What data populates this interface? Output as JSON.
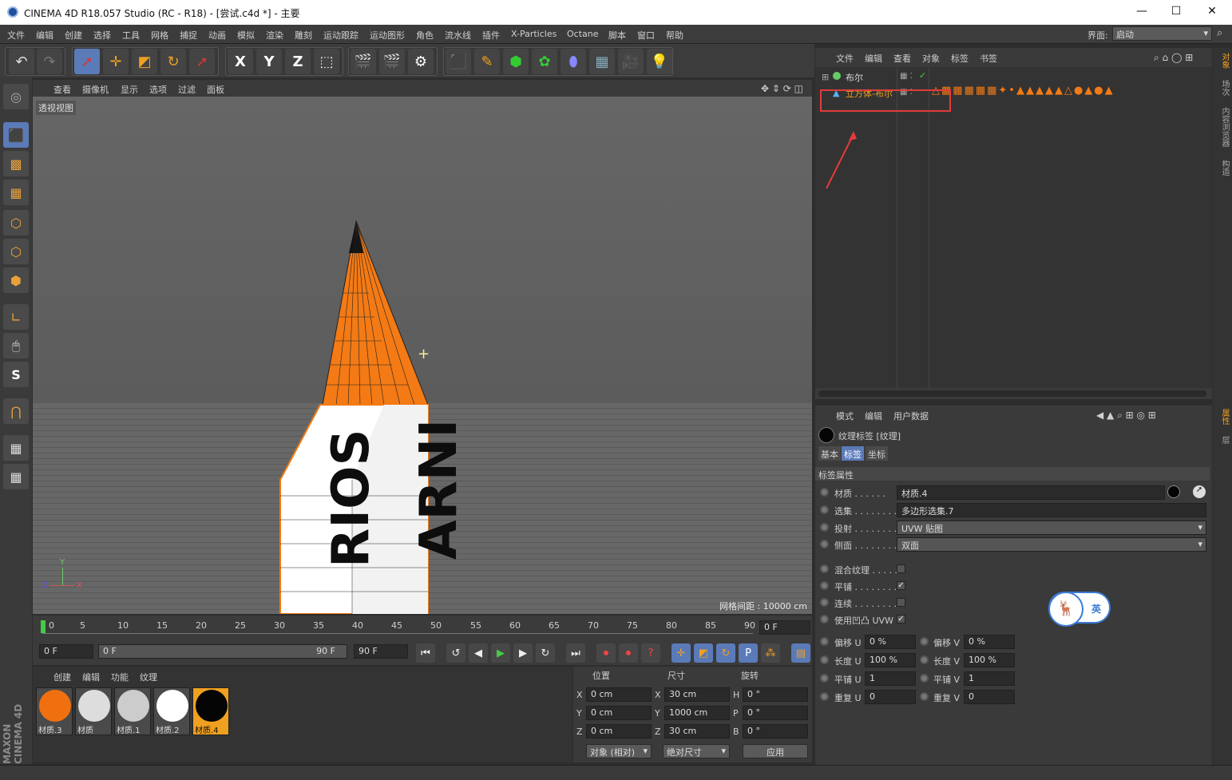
{
  "window": {
    "title": "CINEMA 4D R18.057 Studio (RC - R18) - [尝试.c4d *] - 主要",
    "min": "—",
    "max": "☐",
    "close": "✕"
  },
  "menu": [
    "文件",
    "编辑",
    "创建",
    "选择",
    "工具",
    "网格",
    "捕捉",
    "动画",
    "模拟",
    "渲染",
    "雕刻",
    "运动跟踪",
    "运动图形",
    "角色",
    "流水线",
    "插件",
    "X-Particles",
    "Octane",
    "脚本",
    "窗口",
    "帮助"
  ],
  "layout": {
    "label": "界面:",
    "value": "启动"
  },
  "toolbar": {
    "axis": [
      "X",
      "Y",
      "Z"
    ]
  },
  "viewport": {
    "menu": [
      "查看",
      "摄像机",
      "显示",
      "选项",
      "过滤",
      "面板"
    ],
    "label": "透视视图",
    "grid": "网格间距 : 10000 cm",
    "axis_y": "Y",
    "axis_z": "Z",
    "axis_x": "X",
    "crosshair": "+"
  },
  "timeline": {
    "ticks": [
      "0",
      "5",
      "10",
      "15",
      "20",
      "25",
      "30",
      "35",
      "40",
      "45",
      "50",
      "55",
      "60",
      "65",
      "70",
      "75",
      "80",
      "85",
      "90"
    ],
    "frame": "0 F"
  },
  "transport": {
    "start": "0 F",
    "range_start": "0 F",
    "range_end": "90 F",
    "end": "90 F"
  },
  "materials": {
    "menu": [
      "创建",
      "编辑",
      "功能",
      "纹理"
    ],
    "items": [
      {
        "name": "材质.3",
        "color": "#f07010",
        "selected": false
      },
      {
        "name": "材质",
        "color": "#dddddd",
        "selected": false
      },
      {
        "name": "材质.1",
        "color": "#cccccc",
        "selected": false
      },
      {
        "name": "材质.2",
        "color": "#ffffff",
        "selected": false
      },
      {
        "name": "材质.4",
        "color": "#050505",
        "selected": true
      }
    ]
  },
  "coords": {
    "headers": [
      "位置",
      "尺寸",
      "旋转"
    ],
    "rows": [
      {
        "a": "X",
        "p": "0 cm",
        "s": "30 cm",
        "r": "H",
        "rv": "0 °"
      },
      {
        "a": "Y",
        "p": "0 cm",
        "s": "1000 cm",
        "r": "P",
        "rv": "0 °"
      },
      {
        "a": "Z",
        "p": "0 cm",
        "s": "30 cm",
        "r": "B",
        "rv": "0 °"
      }
    ],
    "mode": "对象 (相对)",
    "size_mode": "绝对尺寸",
    "apply": "应用"
  },
  "objects": {
    "menu": [
      "文件",
      "编辑",
      "查看",
      "对象",
      "标签",
      "书签"
    ],
    "items": [
      {
        "name": "布尔"
      },
      {
        "name": "立方体-布尔"
      }
    ]
  },
  "attributes": {
    "menu": [
      "模式",
      "编辑",
      "用户数据"
    ],
    "title": "纹理标签 [纹理]",
    "tabs": [
      "基本",
      "标签",
      "坐标"
    ],
    "active_tab": "标签",
    "section": "标签属性",
    "rows": [
      {
        "label": "材质 . . . . . .",
        "value": "材质.4"
      },
      {
        "label": "选集 . . . . . . . . .",
        "value": "多边形选集.7"
      },
      {
        "label": "投射 . . . . . . . . .",
        "value": "UVW 贴图"
      },
      {
        "label": "侧面 . . . . . . . . .",
        "value": "双面"
      }
    ],
    "checks": [
      {
        "label": "混合纹理 . . . . .",
        "checked": false
      },
      {
        "label": "平铺 . . . . . . . . .",
        "checked": true
      },
      {
        "label": "连续 . . . . . . . . .",
        "checked": false
      },
      {
        "label": "使用凹凸 UVW",
        "checked": true
      }
    ],
    "pairs": [
      {
        "l1": "偏移 U",
        "v1": "0 %",
        "l2": "偏移 V",
        "v2": "0 %"
      },
      {
        "l1": "长度 U",
        "v1": "100 %",
        "l2": "长度 V",
        "v2": "100 %"
      },
      {
        "l1": "平铺 U",
        "v1": "1",
        "l2": "平铺 V",
        "v2": "1"
      },
      {
        "l1": "重复 U",
        "v1": "0",
        "l2": "重复 V",
        "v2": "0"
      }
    ]
  },
  "ime": {
    "label": "英"
  },
  "right_tabs": [
    "对象",
    "场次",
    "内容浏览器",
    "构造"
  ],
  "right_tabs2": [
    "属性",
    "层"
  ],
  "brand": "MAXON CINEMA 4D"
}
